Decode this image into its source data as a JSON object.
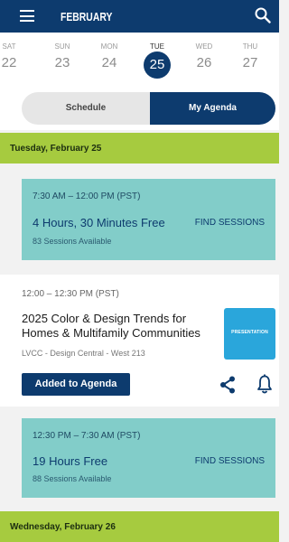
{
  "header": {
    "month": "FEBRUARY"
  },
  "week": [
    {
      "name": "SAT",
      "num": "22"
    },
    {
      "name": "SUN",
      "num": "23"
    },
    {
      "name": "MON",
      "num": "24"
    },
    {
      "name": "TUE",
      "num": "25",
      "active": true
    },
    {
      "name": "WED",
      "num": "26"
    },
    {
      "name": "THU",
      "num": "27"
    }
  ],
  "toggle": {
    "schedule": "Schedule",
    "agenda": "My Agenda"
  },
  "days": [
    {
      "label": "Tuesday, February 25"
    },
    {
      "label": "Wednesday, February 26"
    }
  ],
  "free_blocks": [
    {
      "time": "7:30 AM – 12:00 PM (PST)",
      "duration": "4 Hours, 30 Minutes Free",
      "available": "83 Sessions Available",
      "action": "FIND SESSIONS"
    },
    {
      "time": "12:30 PM – 7:30 AM (PST)",
      "duration": "19 Hours Free",
      "available": "88 Sessions Available",
      "action": "FIND SESSIONS"
    }
  ],
  "session": {
    "time": "12:00 – 12:30 PM (PST)",
    "title": "2025 Color & Design Trends for Homes & Multifamily Communities",
    "location": "LVCC - Design Central - West 213",
    "thumb_label": "PRESENTATION",
    "added_label": "Added to Agenda"
  },
  "colors": {
    "navy": "#0d3b6e",
    "green": "#a6cb3f",
    "teal": "#82cdc9",
    "thumb": "#2aa6db"
  }
}
